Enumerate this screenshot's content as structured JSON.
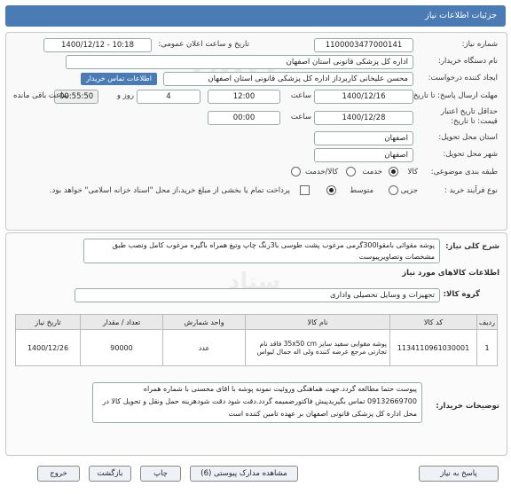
{
  "window": {
    "title": "جزئیات اطلاعات نیاز"
  },
  "form": {
    "need_number_label": "شماره نیاز:",
    "need_number": "1100003477000141",
    "announce_label": "تاریخ و ساعت اعلان عمومی:",
    "announce_value": "1400/12/12 - 10:18",
    "buyer_org_label": "نام دستگاه خریدار:",
    "buyer_org": "اداره کل پزشکی قانونی استان اصفهان",
    "creator_label": "ایجاد کننده درخواست:",
    "creator": "محسن علیخانی کاربرداز اداره کل پزشکی قانونی استان اصفهان",
    "contact_link": "اطلاعات تماس خریدار",
    "deadline_label": "مهلت ارسال پاسخ: تا تاریخ:",
    "deadline_date": "1400/12/16",
    "time_word": "ساعت",
    "deadline_time": "12:00",
    "days_value": "4",
    "days_word": "روز و",
    "remaining_time": "00:55:50",
    "remaining_word": "ساعت باقی مانده",
    "validity_label_1": "حداقل تاریخ اعتبار",
    "validity_label_2": "قیمت: تا تاریخ:",
    "validity_date": "1400/12/28",
    "validity_time": "00:00",
    "province_label": "استان محل تحویل:",
    "province": "اصفهان",
    "city_label": "شهر محل تحویل:",
    "city": "اصفهان",
    "category_label": "طبقه بندی موضوعی:",
    "cat_goods": "کالا",
    "cat_service": "خدمت",
    "cat_both": "کالا/خدمت",
    "process_label": "نوع فرآیند خرید :",
    "proc_small": "جزیی",
    "proc_medium": "متوسط",
    "payment_note": "پرداخت تمام یا بخشی از مبلغ خرید،از محل \"اسناد خزانه اسلامی\" خواهد بود."
  },
  "need_desc": {
    "label": "شرح کلی نیاز:",
    "text": "پوشه مقوائی بامقوا300گرمی مرغوب پشت طوسی با3رنگ چاپ وتیغ همراه باگیره مرغوب کامل ونصب طبق مشخصات وتصاویرپیوست"
  },
  "goods": {
    "section_title": "اطلاعات کالاهای مورد نیاز",
    "group_label": "گروه کالا:",
    "group_value": "تجهیزات و وسایل تحصیلی واداری",
    "headers": [
      "ردیف",
      "کد کالا",
      "نام کالا",
      "واحد شمارش",
      "تعداد / مقدار",
      "تاریخ نیاز"
    ],
    "rows": [
      {
        "row": "1",
        "code": "1134110961030001",
        "name": "پوشه مقوایی سفید سایز 35x50 cm فاقد نام تجارتی مرجع عرضه کننده ولی اله جمال لیواس",
        "unit": "عدد",
        "qty": "90000",
        "date": "1400/12/26"
      }
    ]
  },
  "buyer_notes": {
    "label": "توضیحات خریدار:",
    "text": "پیوست حتما مطالعه گردد.جهت هماهنگی وروئیت نمونه پوشه با اقای محسنی با شماره همراه 09132669700 تماس بگیریدپیش فاکتورضمیمه گردد.دقت شود دقت شودهزینه حمل ونقل و تحویل کالا در محل اداره کل پزشکی قانونی اصفهان بر عهده تامین کننده است"
  },
  "footer": {
    "reply": "پاسخ به نیاز",
    "attachments": "مشاهده مدارک پیوستی (6)",
    "print": "چاپ",
    "back": "بازگشت",
    "exit": "خروج"
  },
  "colors": {
    "header": "#4a7bb5",
    "button_bg": "#eef2f7"
  },
  "icons": [
    "radio-icon",
    "checkbox-icon"
  ]
}
